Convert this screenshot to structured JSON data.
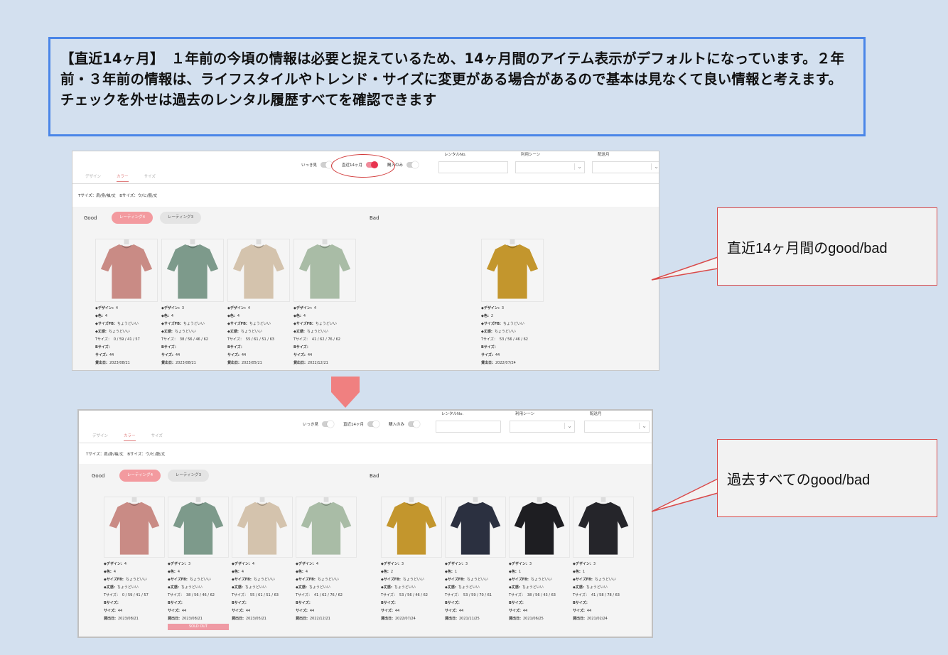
{
  "banner": {
    "text": "【直近14ヶ月】　１年前の今頃の情報は必要と捉えているため、14ヶ月間のアイテム表示がデフォルトになっています。２年前・３年前の情報は、ライフスタイルやトレンド・サイズに変更がある場合があるので基本は見なくて良い情報と考えます。チェックを外せは過去のレンタル履歴すべてを確認できます"
  },
  "callouts": {
    "recent": "直近14ヶ月間のgood/bad",
    "all": "過去すべてのgood/bad"
  },
  "colors": {
    "accent": "#e8334f",
    "callout_border": "#d94a4a",
    "banner_border": "#4a86e8",
    "arrow": "#f08080"
  },
  "screens": [
    {
      "tabs": [
        "デザイン",
        "カラー",
        "サイズ"
      ],
      "active_tab": "カラー",
      "toggles": [
        {
          "label": "いっき見",
          "on": false
        },
        {
          "label": "直近14ヶ月",
          "on": true
        },
        {
          "label": "購入のみ",
          "on": false
        }
      ],
      "filters": {
        "rental_no": "レンタルNo.",
        "scene": "利用シーン",
        "delivery_month": "配送月"
      },
      "size_legend": "Tサイズ：肩/身/袖/丈　Bサイズ：ウ/ヒ/股/丈",
      "good_label": "Good",
      "bad_label": "Bad",
      "rating_pills": [
        "レーティング4",
        "レーティング3"
      ],
      "good_items": [
        {
          "color": "salmon",
          "design": "4",
          "hue": "4",
          "sizefb": "ちょうどいい",
          "length": "ちょうどいい",
          "tsize": "0 / 59 / 41 / 57",
          "bsize": "",
          "size": "44",
          "date": "2023/08/21",
          "sold_out": false
        },
        {
          "color": "sage",
          "design": "3",
          "hue": "4",
          "sizefb": "ちょうどいい",
          "length": "ちょうどいい",
          "tsize": "38 / 56 / 46 / 62",
          "bsize": "",
          "size": "44",
          "date": "2023/08/21",
          "sold_out": false
        },
        {
          "color": "beige",
          "design": "4",
          "hue": "4",
          "sizefb": "ちょうどいい",
          "length": "ちょうどいい",
          "tsize": "55 / 61 / 51 / 63",
          "bsize": "",
          "size": "44",
          "date": "2023/05/21",
          "sold_out": false
        },
        {
          "color": "mint",
          "design": "4",
          "hue": "4",
          "sizefb": "ちょうどいい",
          "length": "ちょうどいい",
          "tsize": "41 / 62 / 76 / 62",
          "bsize": "",
          "size": "44",
          "date": "2022/12/21",
          "sold_out": false
        }
      ],
      "bad_items": [
        {
          "color": "mustard",
          "design": "3",
          "hue": "2",
          "sizefb": "ちょうどいい",
          "length": "ちょうどいい",
          "tsize": "53 / 56 / 46 / 62",
          "bsize": "",
          "size": "44",
          "date": "2022/07/24",
          "sold_out": false
        }
      ]
    },
    {
      "tabs": [
        "デザイン",
        "カラー",
        "サイズ"
      ],
      "active_tab": "カラー",
      "toggles": [
        {
          "label": "いっき見",
          "on": false
        },
        {
          "label": "直近14ヶ月",
          "on": false
        },
        {
          "label": "購入のみ",
          "on": false
        }
      ],
      "filters": {
        "rental_no": "レンタルNo.",
        "scene": "利用シーン",
        "delivery_month": "配送月"
      },
      "size_legend": "Tサイズ：肩/身/袖/丈　Bサイズ：ウ/ヒ/股/丈",
      "good_label": "Good",
      "bad_label": "Bad",
      "rating_pills": [
        "レーティング4",
        "レーティング3"
      ],
      "good_items": [
        {
          "color": "salmon",
          "design": "4",
          "hue": "4",
          "sizefb": "ちょうどいい",
          "length": "ちょうどいい",
          "tsize": "0 / 59 / 41 / 57",
          "bsize": "",
          "size": "44",
          "date": "2023/08/21",
          "sold_out": false
        },
        {
          "color": "sage",
          "design": "3",
          "hue": "4",
          "sizefb": "ちょうどいい",
          "length": "ちょうどいい",
          "tsize": "38 / 56 / 46 / 62",
          "bsize": "",
          "size": "44",
          "date": "2023/08/21",
          "sold_out": true
        },
        {
          "color": "beige",
          "design": "4",
          "hue": "4",
          "sizefb": "ちょうどいい",
          "length": "ちょうどいい",
          "tsize": "55 / 61 / 51 / 63",
          "bsize": "",
          "size": "44",
          "date": "2023/05/21",
          "sold_out": false
        },
        {
          "color": "mint",
          "design": "4",
          "hue": "4",
          "sizefb": "ちょうどいい",
          "length": "ちょうどいい",
          "tsize": "41 / 62 / 76 / 62",
          "bsize": "",
          "size": "44",
          "date": "2022/12/21",
          "sold_out": false
        }
      ],
      "bad_items": [
        {
          "color": "mustard",
          "design": "3",
          "hue": "2",
          "sizefb": "ちょうどいい",
          "length": "ちょうどいい",
          "tsize": "53 / 56 / 46 / 62",
          "bsize": "",
          "size": "44",
          "date": "2022/07/24",
          "sold_out": false
        },
        {
          "color": "navy",
          "design": "3",
          "hue": "1",
          "sizefb": "ちょうどいい",
          "length": "ちょうどいい",
          "tsize": "53 / 59 / 70 / 61",
          "bsize": "",
          "size": "44",
          "date": "2021/11/25",
          "sold_out": false
        },
        {
          "color": "black",
          "design": "3",
          "hue": "1",
          "sizefb": "ちょうどいい",
          "length": "ちょうどいい",
          "tsize": "38 / 56 / 43 / 63",
          "bsize": "",
          "size": "44",
          "date": "2021/06/25",
          "sold_out": false
        },
        {
          "color": "black2",
          "design": "3",
          "hue": "1",
          "sizefb": "ちょうどいい",
          "length": "ちょうどいい",
          "tsize": "41 / 58 / 78 / 63",
          "bsize": "",
          "size": "44",
          "date": "2021/02/24",
          "sold_out": false
        }
      ]
    }
  ],
  "field_labels": {
    "design": "◆デザイン:",
    "hue": "◆色:",
    "sizefb": "◆サイズFB:",
    "length": "◆丈感:",
    "tsize": "Tサイズ：",
    "bsize": "Bサイズ：",
    "size": "サイズ:",
    "date": "貸出日:",
    "sold_out": "SOLD OUT"
  }
}
